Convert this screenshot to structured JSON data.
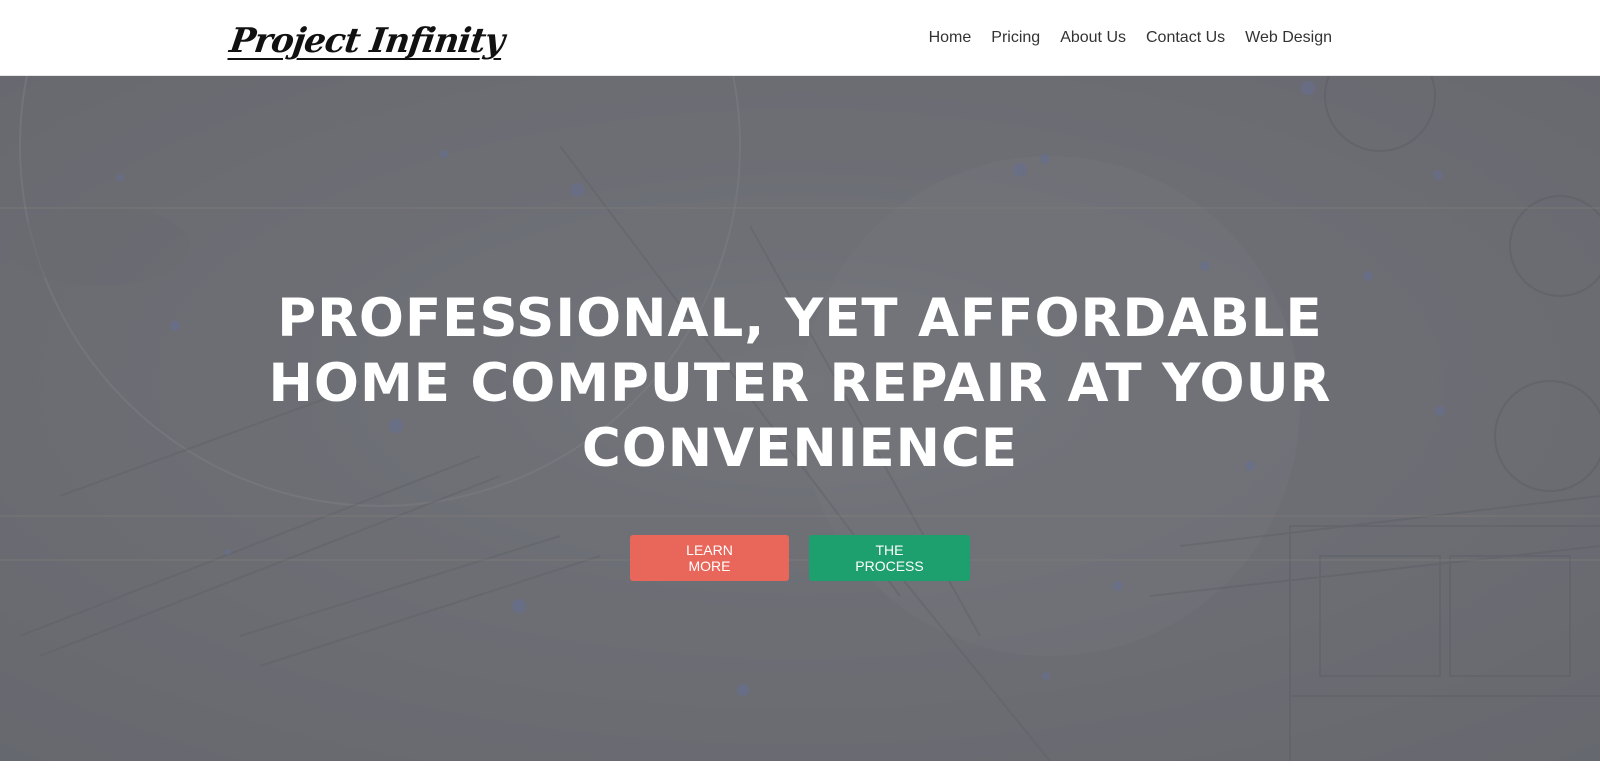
{
  "brand": {
    "logo_text": "Project Infinity"
  },
  "nav": {
    "items": [
      {
        "label": "Home"
      },
      {
        "label": "Pricing"
      },
      {
        "label": "About Us"
      },
      {
        "label": "Contact Us"
      },
      {
        "label": "Web Design"
      }
    ]
  },
  "hero": {
    "title": "PROFESSIONAL, YET AFFORDABLE HOME COMPUTER REPAIR AT YOUR CONVENIENCE",
    "learn_more_label": "LEARN MORE",
    "process_label": "THE PROCESS"
  },
  "colors": {
    "learn_more": "#e8665a",
    "process": "#1da06d",
    "nav_text": "#333333",
    "hero_text": "#ffffff"
  },
  "icons": {
    "logo_mark": "infinity-icon"
  }
}
